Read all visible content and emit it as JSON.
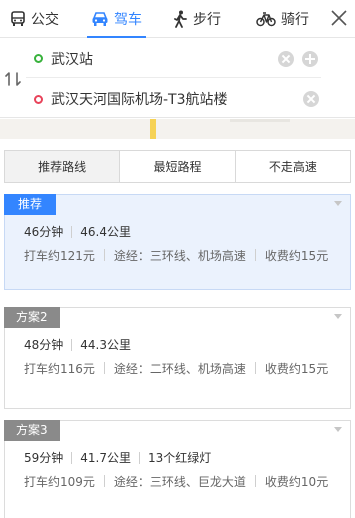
{
  "modes": [
    {
      "label": "公交",
      "icon": "bus-icon"
    },
    {
      "label": "驾车",
      "icon": "car-icon",
      "active": true
    },
    {
      "label": "步行",
      "icon": "walk-icon"
    },
    {
      "label": "骑行",
      "icon": "bike-icon"
    }
  ],
  "route": {
    "start": "武汉站",
    "end": "武汉天河国际机场-T3航站楼"
  },
  "strategies": [
    "推荐路线",
    "最短路程",
    "不走高速"
  ],
  "active_strategy": 0,
  "plans": [
    {
      "tag": "推荐",
      "time": "46分钟",
      "distance": "46.4公里",
      "taxi": "打车约121元",
      "via": "途经：三环线、机场高速",
      "toll": "收费约15元"
    },
    {
      "tag": "方案2",
      "time": "48分钟",
      "distance": "44.3公里",
      "taxi": "打车约116元",
      "via": "途经：二环线、机场高速",
      "toll": "收费约15元"
    },
    {
      "tag": "方案3",
      "time": "59分钟",
      "distance": "41.7公里",
      "lights": "13个红绿灯",
      "taxi": "打车约109元",
      "via": "途经：三环线、巨龙大道",
      "toll": "收费约10元"
    }
  ],
  "colors": {
    "accent": "#3385ff",
    "selected_bg": "#ebf2fd",
    "tag_gray": "#8a8a8a",
    "start_dot": "#38b23c",
    "end_dot": "#e8435a"
  }
}
